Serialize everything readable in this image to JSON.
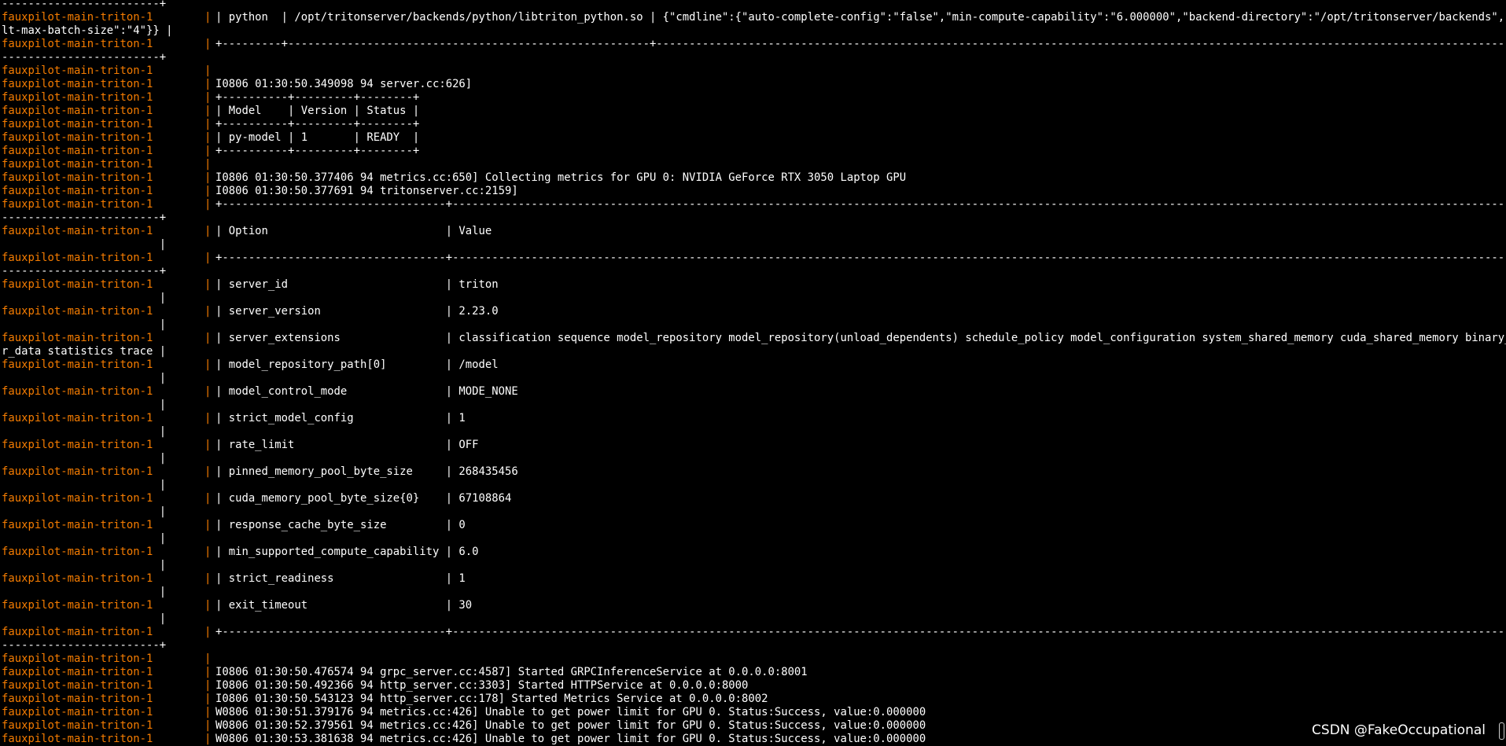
{
  "colors": {
    "background": "#000000",
    "prefix": "#f57c00",
    "text": "#ffffff"
  },
  "lines": [
    {
      "kind": "cont",
      "text": "------------------------+"
    },
    {
      "kind": "log",
      "prefix": "fauxpilot-main-triton-1",
      "text": "| python  | /opt/tritonserver/backends/python/libtriton_python.so | {\"cmdline\":{\"auto-complete-config\":\"false\",\"min-compute-capability\":\"6.000000\",\"backend-directory\":\"/opt/tritonserver/backends\",\"defau"
    },
    {
      "kind": "cont",
      "text": "lt-max-batch-size\":\"4\"}} |"
    },
    {
      "kind": "log",
      "prefix": "fauxpilot-main-triton-1",
      "text": "+---------+-------------------------------------------------------+------------------------------------------------------------------------------------------------------------------------------------------"
    },
    {
      "kind": "cont",
      "text": "------------------------+"
    },
    {
      "kind": "log",
      "prefix": "fauxpilot-main-triton-1",
      "text": ""
    },
    {
      "kind": "log",
      "prefix": "fauxpilot-main-triton-1",
      "text": "I0806 01:30:50.349098 94 server.cc:626]"
    },
    {
      "kind": "log",
      "prefix": "fauxpilot-main-triton-1",
      "text": "+----------+---------+--------+"
    },
    {
      "kind": "log",
      "prefix": "fauxpilot-main-triton-1",
      "text": "| Model    | Version | Status |"
    },
    {
      "kind": "log",
      "prefix": "fauxpilot-main-triton-1",
      "text": "+----------+---------+--------+"
    },
    {
      "kind": "log",
      "prefix": "fauxpilot-main-triton-1",
      "text": "| py-model | 1       | READY  |"
    },
    {
      "kind": "log",
      "prefix": "fauxpilot-main-triton-1",
      "text": "+----------+---------+--------+"
    },
    {
      "kind": "log",
      "prefix": "fauxpilot-main-triton-1",
      "text": ""
    },
    {
      "kind": "log",
      "prefix": "fauxpilot-main-triton-1",
      "text": "I0806 01:30:50.377406 94 metrics.cc:650] Collecting metrics for GPU 0: NVIDIA GeForce RTX 3050 Laptop GPU"
    },
    {
      "kind": "log",
      "prefix": "fauxpilot-main-triton-1",
      "text": "I0806 01:30:50.377691 94 tritonserver.cc:2159]"
    },
    {
      "kind": "log",
      "prefix": "fauxpilot-main-triton-1",
      "text": "+----------------------------------+------------------------------------------------------------------------------------------------------------------------------------------------------------------------------"
    },
    {
      "kind": "cont",
      "text": "------------------------+"
    },
    {
      "kind": "log",
      "prefix": "fauxpilot-main-triton-1",
      "text": "| Option                           | Value"
    },
    {
      "kind": "cont",
      "text": "                        |"
    },
    {
      "kind": "log",
      "prefix": "fauxpilot-main-triton-1",
      "text": "+----------------------------------+------------------------------------------------------------------------------------------------------------------------------------------------------------------------------"
    },
    {
      "kind": "cont",
      "text": "------------------------+"
    },
    {
      "kind": "log",
      "prefix": "fauxpilot-main-triton-1",
      "text": "| server_id                        | triton"
    },
    {
      "kind": "cont",
      "text": "                        |"
    },
    {
      "kind": "log",
      "prefix": "fauxpilot-main-triton-1",
      "text": "| server_version                   | 2.23.0"
    },
    {
      "kind": "cont",
      "text": "                        |"
    },
    {
      "kind": "log",
      "prefix": "fauxpilot-main-triton-1",
      "text": "| server_extensions                | classification sequence model_repository model_repository(unload_dependents) schedule_policy model_configuration system_shared_memory cuda_shared_memory binary_tenso"
    },
    {
      "kind": "cont",
      "text": "r_data statistics trace |"
    },
    {
      "kind": "log",
      "prefix": "fauxpilot-main-triton-1",
      "text": "| model_repository_path[0]         | /model"
    },
    {
      "kind": "cont",
      "text": "                        |"
    },
    {
      "kind": "log",
      "prefix": "fauxpilot-main-triton-1",
      "text": "| model_control_mode               | MODE_NONE"
    },
    {
      "kind": "cont",
      "text": "                        |"
    },
    {
      "kind": "log",
      "prefix": "fauxpilot-main-triton-1",
      "text": "| strict_model_config              | 1"
    },
    {
      "kind": "cont",
      "text": "                        |"
    },
    {
      "kind": "log",
      "prefix": "fauxpilot-main-triton-1",
      "text": "| rate_limit                       | OFF"
    },
    {
      "kind": "cont",
      "text": "                        |"
    },
    {
      "kind": "log",
      "prefix": "fauxpilot-main-triton-1",
      "text": "| pinned_memory_pool_byte_size     | 268435456"
    },
    {
      "kind": "cont",
      "text": "                        |"
    },
    {
      "kind": "log",
      "prefix": "fauxpilot-main-triton-1",
      "text": "| cuda_memory_pool_byte_size{0}    | 67108864"
    },
    {
      "kind": "cont",
      "text": "                        |"
    },
    {
      "kind": "log",
      "prefix": "fauxpilot-main-triton-1",
      "text": "| response_cache_byte_size         | 0"
    },
    {
      "kind": "cont",
      "text": "                        |"
    },
    {
      "kind": "log",
      "prefix": "fauxpilot-main-triton-1",
      "text": "| min_supported_compute_capability | 6.0"
    },
    {
      "kind": "cont",
      "text": "                        |"
    },
    {
      "kind": "log",
      "prefix": "fauxpilot-main-triton-1",
      "text": "| strict_readiness                 | 1"
    },
    {
      "kind": "cont",
      "text": "                        |"
    },
    {
      "kind": "log",
      "prefix": "fauxpilot-main-triton-1",
      "text": "| exit_timeout                     | 30"
    },
    {
      "kind": "cont",
      "text": "                        |"
    },
    {
      "kind": "log",
      "prefix": "fauxpilot-main-triton-1",
      "text": "+----------------------------------+------------------------------------------------------------------------------------------------------------------------------------------------------------------------------"
    },
    {
      "kind": "cont",
      "text": "------------------------+"
    },
    {
      "kind": "log",
      "prefix": "fauxpilot-main-triton-1",
      "text": ""
    },
    {
      "kind": "log",
      "prefix": "fauxpilot-main-triton-1",
      "text": "I0806 01:30:50.476574 94 grpc_server.cc:4587] Started GRPCInferenceService at 0.0.0.0:8001"
    },
    {
      "kind": "log",
      "prefix": "fauxpilot-main-triton-1",
      "text": "I0806 01:30:50.492366 94 http_server.cc:3303] Started HTTPService at 0.0.0.0:8000"
    },
    {
      "kind": "log",
      "prefix": "fauxpilot-main-triton-1",
      "text": "I0806 01:30:50.543123 94 http_server.cc:178] Started Metrics Service at 0.0.0.0:8002"
    },
    {
      "kind": "log",
      "prefix": "fauxpilot-main-triton-1",
      "text": "W0806 01:30:51.379176 94 metrics.cc:426] Unable to get power limit for GPU 0. Status:Success, value:0.000000"
    },
    {
      "kind": "log",
      "prefix": "fauxpilot-main-triton-1",
      "text": "W0806 01:30:52.379561 94 metrics.cc:426] Unable to get power limit for GPU 0. Status:Success, value:0.000000"
    },
    {
      "kind": "log",
      "prefix": "fauxpilot-main-triton-1",
      "text": "W0806 01:30:53.381638 94 metrics.cc:426] Unable to get power limit for GPU 0. Status:Success, value:0.000000"
    }
  ],
  "pipe_char": "|",
  "watermark": "CSDN @FakeOccupational"
}
